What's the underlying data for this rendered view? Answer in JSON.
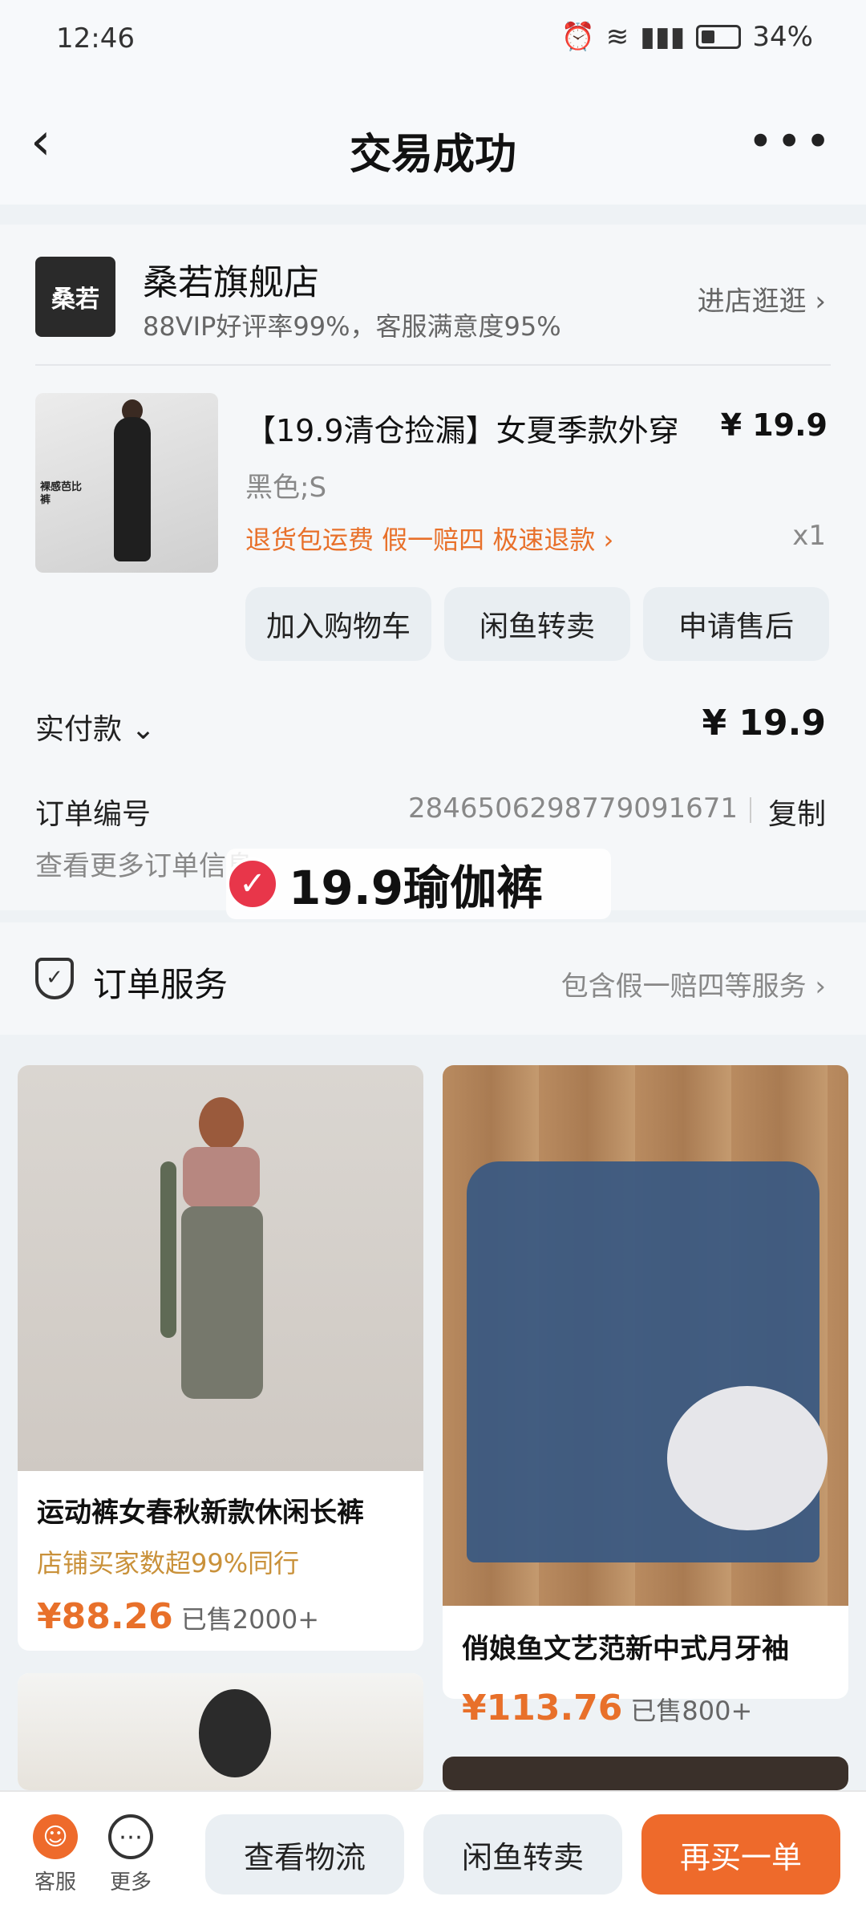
{
  "status_bar": {
    "time": "12:46",
    "battery": "34%"
  },
  "header": {
    "title": "交易成功",
    "back_icon": "‹",
    "more_icon": "•••"
  },
  "store": {
    "logo_text": "桑若",
    "name": "桑若旗舰店",
    "rating": "88VIP好评率99%，客服满意度95%",
    "enter_label": "进店逛逛 ›"
  },
  "product": {
    "title": "【19.9清仓捡漏】女夏季款外穿",
    "price": "¥ 19.9",
    "sku": "黑色;S",
    "tags": "退货包运费  假一赔四  极速退款 ›",
    "quantity": "x1",
    "image_tag": "裸感芭比裤"
  },
  "actions": {
    "add_cart": "加入购物车",
    "resell": "闲鱼转卖",
    "after_sale": "申请售后"
  },
  "payment": {
    "label": "实付款 ⌄",
    "value": "¥ 19.9"
  },
  "order": {
    "no_label": "订单编号",
    "no_value": "2846506298779091671",
    "copy": "复制",
    "more": "查看更多订单信息"
  },
  "overlay": {
    "icon": "✓",
    "text": "19.9瑜伽裤"
  },
  "service": {
    "title": "订单服务",
    "desc": "包含假一赔四等服务 ›"
  },
  "recommendations": [
    {
      "title": "运动裤女春秋新款休闲长裤",
      "subtitle": "店铺买家数超99%同行",
      "price": "¥88.26",
      "sold": "已售2000+"
    },
    {
      "title": "俏娘鱼文艺范新中式月牙袖",
      "price": "¥113.76",
      "sold": "已售800+"
    }
  ],
  "bottom": {
    "service_label": "客服",
    "more_label": "更多",
    "logistics": "查看物流",
    "resell": "闲鱼转卖",
    "buy_again": "再买一单"
  },
  "colors": {
    "accent": "#ee6a2b",
    "tag_orange": "#e8702a",
    "badge_red": "#e8364a"
  }
}
